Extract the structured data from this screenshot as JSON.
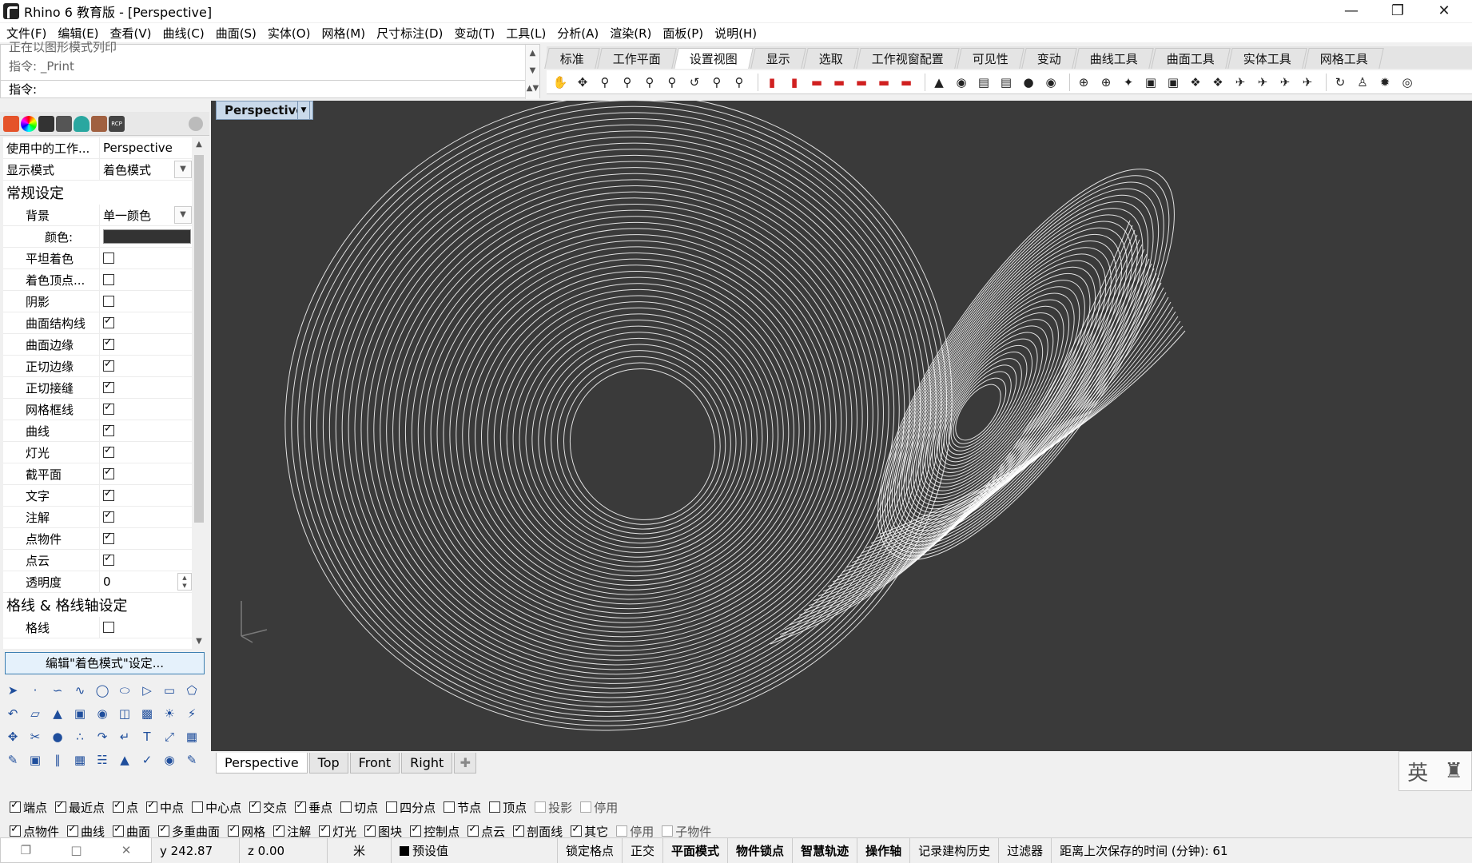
{
  "window": {
    "title": "Rhino 6 教育版 - [Perspective]"
  },
  "menu": [
    "文件(F)",
    "编辑(E)",
    "查看(V)",
    "曲线(C)",
    "曲面(S)",
    "实体(O)",
    "网格(M)",
    "尺寸标注(D)",
    "变动(T)",
    "工具(L)",
    "分析(A)",
    "渲染(R)",
    "面板(P)",
    "说明(H)"
  ],
  "command": {
    "history1": "正在以图形模式列印",
    "history2": "指令: _Print",
    "prompt": "指令:"
  },
  "toolbar_tabs": [
    "标准",
    "工作平面",
    "设置视图",
    "显示",
    "选取",
    "工作视窗配置",
    "可见性",
    "变动",
    "曲线工具",
    "曲面工具",
    "实体工具",
    "网格工具"
  ],
  "toolbar_active_tab": "设置视图",
  "panel": {
    "viewport_label": "使用中的工作...",
    "viewport_value": "Perspective",
    "display_mode_label": "显示模式",
    "display_mode_value": "着色模式",
    "general_section": "常规设定",
    "background_label": "背景",
    "background_value": "单一颜色",
    "color_label": "颜色:",
    "checks": [
      {
        "label": "平坦着色",
        "checked": false
      },
      {
        "label": "着色顶点...",
        "checked": false
      },
      {
        "label": "阴影",
        "checked": false
      },
      {
        "label": "曲面结构线",
        "checked": true
      },
      {
        "label": "曲面边缘",
        "checked": true
      },
      {
        "label": "正切边缘",
        "checked": true
      },
      {
        "label": "正切接缝",
        "checked": true
      },
      {
        "label": "网格框线",
        "checked": true
      },
      {
        "label": "曲线",
        "checked": true
      },
      {
        "label": "灯光",
        "checked": true
      },
      {
        "label": "截平面",
        "checked": true
      },
      {
        "label": "文字",
        "checked": true
      },
      {
        "label": "注解",
        "checked": true
      },
      {
        "label": "点物件",
        "checked": true
      },
      {
        "label": "点云",
        "checked": true
      }
    ],
    "transparency_label": "透明度",
    "transparency_value": "0",
    "grid_section": "格线 & 格线轴设定",
    "grid_label": "格线",
    "edit_button": "编辑\"着色模式\"设定..."
  },
  "viewport": {
    "name": "Perspective",
    "background": "#3a3a3a"
  },
  "view_tabs": [
    "Perspective",
    "Top",
    "Front",
    "Right"
  ],
  "ime": {
    "lang": "英"
  },
  "osnap_row1": [
    {
      "label": "端点",
      "checked": true,
      "disabled": false
    },
    {
      "label": "最近点",
      "checked": true,
      "disabled": false
    },
    {
      "label": "点",
      "checked": true,
      "disabled": false
    },
    {
      "label": "中点",
      "checked": true,
      "disabled": false
    },
    {
      "label": "中心点",
      "checked": false,
      "disabled": false
    },
    {
      "label": "交点",
      "checked": true,
      "disabled": false
    },
    {
      "label": "垂点",
      "checked": true,
      "disabled": false
    },
    {
      "label": "切点",
      "checked": false,
      "disabled": false
    },
    {
      "label": "四分点",
      "checked": false,
      "disabled": false
    },
    {
      "label": "节点",
      "checked": false,
      "disabled": false
    },
    {
      "label": "顶点",
      "checked": false,
      "disabled": false
    },
    {
      "label": "投影",
      "checked": false,
      "disabled": true
    },
    {
      "label": "停用",
      "checked": false,
      "disabled": true
    }
  ],
  "osnap_row2": [
    {
      "label": "点物件",
      "checked": true,
      "disabled": false
    },
    {
      "label": "曲线",
      "checked": true,
      "disabled": false
    },
    {
      "label": "曲面",
      "checked": true,
      "disabled": false
    },
    {
      "label": "多重曲面",
      "checked": true,
      "disabled": false
    },
    {
      "label": "网格",
      "checked": true,
      "disabled": false
    },
    {
      "label": "注解",
      "checked": true,
      "disabled": false
    },
    {
      "label": "灯光",
      "checked": true,
      "disabled": false
    },
    {
      "label": "图块",
      "checked": true,
      "disabled": false
    },
    {
      "label": "控制点",
      "checked": true,
      "disabled": false
    },
    {
      "label": "点云",
      "checked": true,
      "disabled": false
    },
    {
      "label": "剖面线",
      "checked": true,
      "disabled": false
    },
    {
      "label": "其它",
      "checked": true,
      "disabled": false
    },
    {
      "label": "停用",
      "checked": false,
      "disabled": true
    },
    {
      "label": "子物件",
      "checked": false,
      "disabled": true
    }
  ],
  "status": {
    "y": "y 242.87",
    "z": "z 0.00",
    "unit": "米",
    "layer": "预设值",
    "grid_snap": "锁定格点",
    "ortho": "正交",
    "planar": "平面模式",
    "osnap": "物件锁点",
    "smarttrack": "智慧轨迹",
    "gumball": "操作轴",
    "history": "记录建构历史",
    "filter": "过滤器",
    "save_time": "距离上次保存的时间 (分钟): 61"
  }
}
